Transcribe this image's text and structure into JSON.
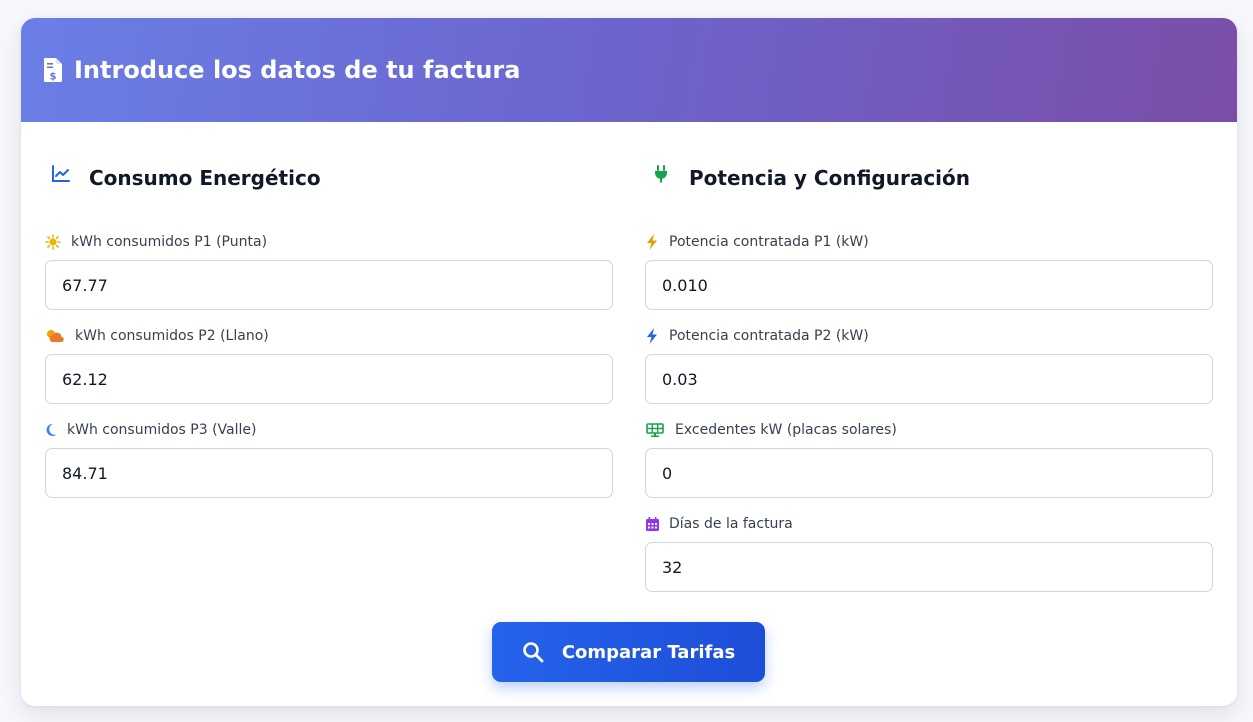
{
  "header": {
    "title": "Introduce los datos de tu factura",
    "icon": "invoice-dollar-icon"
  },
  "consumo": {
    "title": "Consumo Energético",
    "icon": "chart-line-icon",
    "fields": [
      {
        "label": "kWh consumidos P1 (Punta)",
        "value": "67.77",
        "icon": "sun-icon",
        "icon_color": "#eab308"
      },
      {
        "label": "kWh consumidos P2 (Llano)",
        "value": "62.12",
        "icon": "cloud-sun-icon",
        "icon_color": "#ea7a2b"
      },
      {
        "label": "kWh consumidos P3 (Valle)",
        "value": "84.71",
        "icon": "moon-icon",
        "icon_color": "#3b82f6"
      }
    ]
  },
  "potencia": {
    "title": "Potencia y Configuración",
    "icon": "plug-icon",
    "fields": [
      {
        "label": "Potencia contratada P1 (kW)",
        "value": "0.010",
        "icon": "bolt-icon",
        "icon_color": "#e0a100"
      },
      {
        "label": "Potencia contratada P2 (kW)",
        "value": "0.03",
        "icon": "bolt-icon",
        "icon_color": "#2563eb"
      },
      {
        "label": "Excedentes kW (placas solares)",
        "value": "0",
        "icon": "solar-panel-icon",
        "icon_color": "#16a34a"
      },
      {
        "label": "Días de la factura",
        "value": "32",
        "icon": "calendar-icon",
        "icon_color": "#9333ea"
      }
    ]
  },
  "submit": {
    "label": "Comparar Tarifas",
    "icon": "search-icon"
  },
  "colors": {
    "accent": "#2563eb",
    "header_gradient_start": "#6a7fe6",
    "header_gradient_end": "#7a4ea8",
    "chart_icon": "#2563eb",
    "plug_icon": "#16a34a"
  }
}
